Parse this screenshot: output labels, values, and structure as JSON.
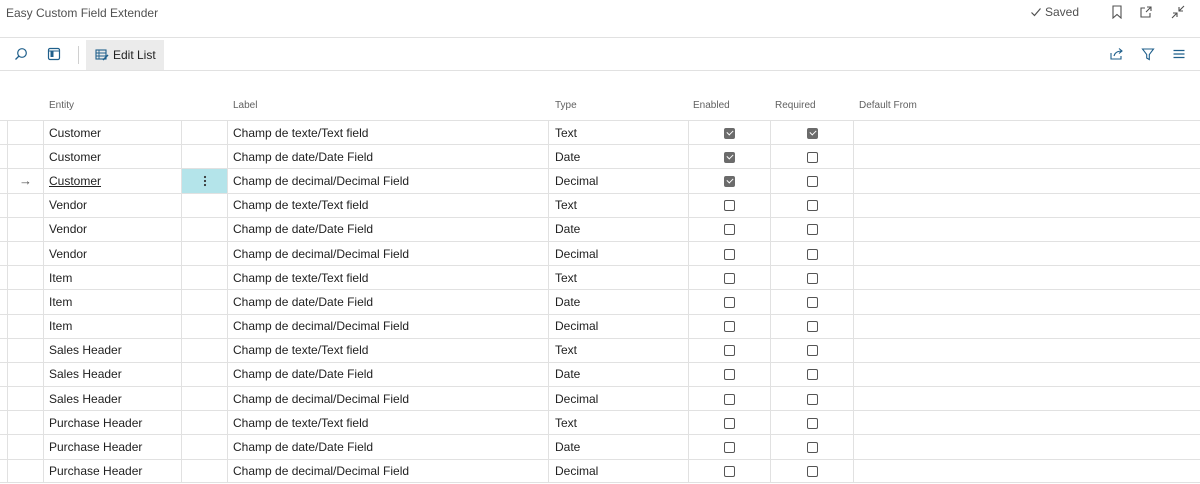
{
  "window": {
    "title": "Easy Custom Field Extender",
    "saved_label": "Saved"
  },
  "actionbar": {
    "edit_list_label": "Edit List"
  },
  "table": {
    "headers": {
      "entity": "Entity",
      "label": "Label",
      "type": "Type",
      "enabled": "Enabled",
      "required": "Required",
      "default_from": "Default From"
    },
    "rows": [
      {
        "entity": "Customer",
        "label": "Champ de texte/Text field",
        "type": "Text",
        "enabled": true,
        "required": true,
        "selected": false
      },
      {
        "entity": "Customer",
        "label": "Champ de date/Date Field",
        "type": "Date",
        "enabled": true,
        "required": false,
        "selected": false
      },
      {
        "entity": "Customer",
        "label": "Champ de decimal/Decimal Field",
        "type": "Decimal",
        "enabled": true,
        "required": false,
        "selected": true
      },
      {
        "entity": "Vendor",
        "label": "Champ de texte/Text field",
        "type": "Text",
        "enabled": false,
        "required": false,
        "selected": false
      },
      {
        "entity": "Vendor",
        "label": "Champ de date/Date Field",
        "type": "Date",
        "enabled": false,
        "required": false,
        "selected": false
      },
      {
        "entity": "Vendor",
        "label": "Champ de decimal/Decimal Field",
        "type": "Decimal",
        "enabled": false,
        "required": false,
        "selected": false
      },
      {
        "entity": "Item",
        "label": "Champ de texte/Text field",
        "type": "Text",
        "enabled": false,
        "required": false,
        "selected": false
      },
      {
        "entity": "Item",
        "label": "Champ de date/Date Field",
        "type": "Date",
        "enabled": false,
        "required": false,
        "selected": false
      },
      {
        "entity": "Item",
        "label": "Champ de decimal/Decimal Field",
        "type": "Decimal",
        "enabled": false,
        "required": false,
        "selected": false
      },
      {
        "entity": "Sales Header",
        "label": "Champ de texte/Text field",
        "type": "Text",
        "enabled": false,
        "required": false,
        "selected": false
      },
      {
        "entity": "Sales Header",
        "label": "Champ de date/Date Field",
        "type": "Date",
        "enabled": false,
        "required": false,
        "selected": false
      },
      {
        "entity": "Sales Header",
        "label": "Champ de decimal/Decimal Field",
        "type": "Decimal",
        "enabled": false,
        "required": false,
        "selected": false
      },
      {
        "entity": "Purchase Header",
        "label": "Champ de texte/Text field",
        "type": "Text",
        "enabled": false,
        "required": false,
        "selected": false
      },
      {
        "entity": "Purchase Header",
        "label": "Champ de date/Date Field",
        "type": "Date",
        "enabled": false,
        "required": false,
        "selected": false
      },
      {
        "entity": "Purchase Header",
        "label": "Champ de decimal/Decimal Field",
        "type": "Decimal",
        "enabled": false,
        "required": false,
        "selected": false
      }
    ]
  },
  "icons": {
    "title_bar": [
      "check-icon",
      "bookmark-icon",
      "open-new-window-icon",
      "collapse-icon"
    ],
    "action_bar": [
      "search-icon",
      "layout-icon",
      "edit-list-icon",
      "share-icon",
      "filter-icon",
      "list-view-icon"
    ]
  },
  "colors": {
    "selected_cell": "#b4e4ea",
    "checked_box": "#6b6b6b"
  }
}
